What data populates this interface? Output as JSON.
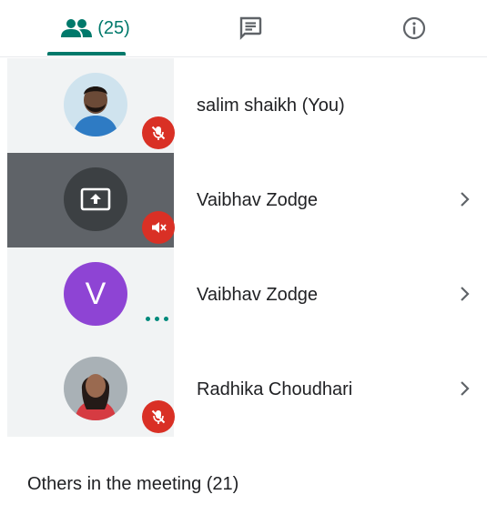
{
  "tabs": {
    "people_count": "(25)",
    "people_icon": "people-icon",
    "chat_icon": "chat-icon",
    "info_icon": "info-icon",
    "accent": "#00796b"
  },
  "participants": [
    {
      "name": "salim shaikh (You)",
      "avatar": "photo",
      "status": "muted"
    },
    {
      "name": "Vaibhav Zodge",
      "avatar": "present-screen-icon",
      "status": "muted"
    },
    {
      "name": "Vaibhav Zodge",
      "avatar_letter": "V",
      "status": "speaking"
    },
    {
      "name": "Radhika Choudhari",
      "avatar": "photo",
      "status": "muted"
    }
  ],
  "others_title": "Others in the meeting (21)",
  "colors": {
    "muted_badge": "#d93025",
    "letter_avatar": "#8e44d4",
    "presenting_tile": "#5f6368"
  }
}
